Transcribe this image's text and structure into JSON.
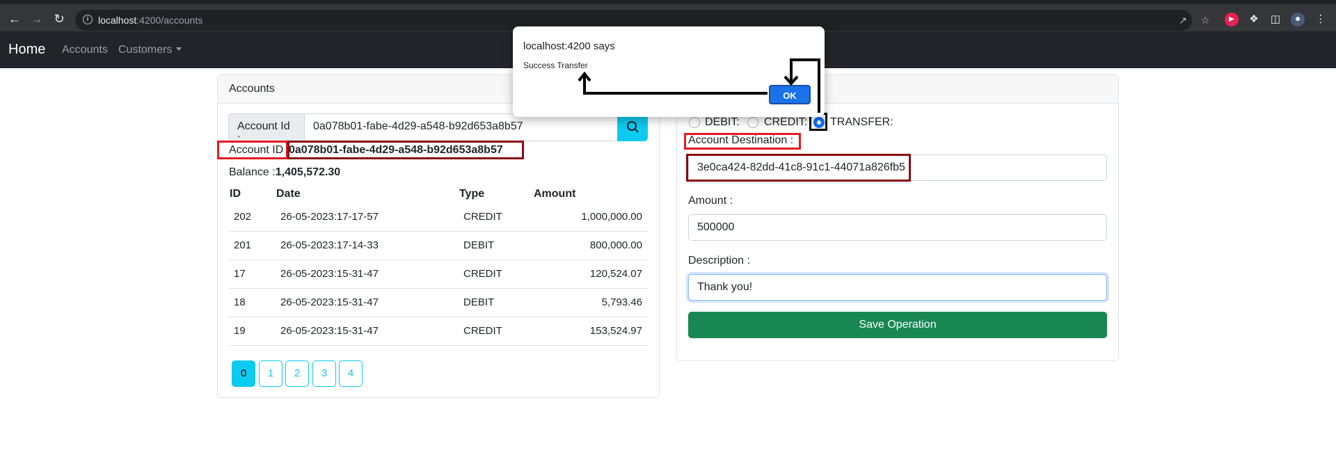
{
  "browser": {
    "url_host": "localhost",
    "url_path": ":4200/accounts"
  },
  "navbar": {
    "brand": "Home",
    "accounts": "Accounts",
    "customers": "Customers"
  },
  "accounts_card": {
    "title": "Accounts",
    "search_label": "Account Id :",
    "search_value": "0a078b01-fabe-4d29-a548-b92d653a8b57",
    "account_id_label": "Account ID",
    "account_id_value": "0a078b01-fabe-4d29-a548-b92d653a8b57",
    "balance_label": "Balance :",
    "balance_value": "1,405,572.30",
    "columns": [
      "ID",
      "Date",
      "Type",
      "Amount"
    ],
    "rows": [
      {
        "id": "202",
        "date": "26-05-2023:17-17-57",
        "type": "CREDIT",
        "amount": "1,000,000.00"
      },
      {
        "id": "201",
        "date": "26-05-2023:17-14-33",
        "type": "DEBIT",
        "amount": "800,000.00"
      },
      {
        "id": "17",
        "date": "26-05-2023:15-31-47",
        "type": "CREDIT",
        "amount": "120,524.07"
      },
      {
        "id": "18",
        "date": "26-05-2023:15-31-47",
        "type": "DEBIT",
        "amount": "5,793.46"
      },
      {
        "id": "19",
        "date": "26-05-2023:15-31-47",
        "type": "CREDIT",
        "amount": "153,524.97"
      }
    ],
    "pages": [
      "0",
      "1",
      "2",
      "3",
      "4"
    ],
    "active_page": "0"
  },
  "operation_form": {
    "radio_debit": "DEBIT:",
    "radio_credit": "CREDIT:",
    "radio_transfer": "TRANSFER:",
    "selected": "TRANSFER",
    "destination_label": "Account Destination :",
    "destination_value": "3e0ca424-82dd-41c8-91c1-44071a826fb5",
    "amount_label": "Amount :",
    "amount_value": "500000",
    "description_label": "Description :",
    "description_value": "Thank you!",
    "save_label": "Save Operation"
  },
  "dialog": {
    "title": "localhost:4200 says",
    "message": "Success Transfer",
    "ok_label": "OK"
  },
  "colors": {
    "accent": "#0dcaf0",
    "save": "#198754",
    "dialog_ok": "#1a73e8",
    "annotation_red": "#e31b23",
    "annotation_dark": "#8b0a12"
  }
}
